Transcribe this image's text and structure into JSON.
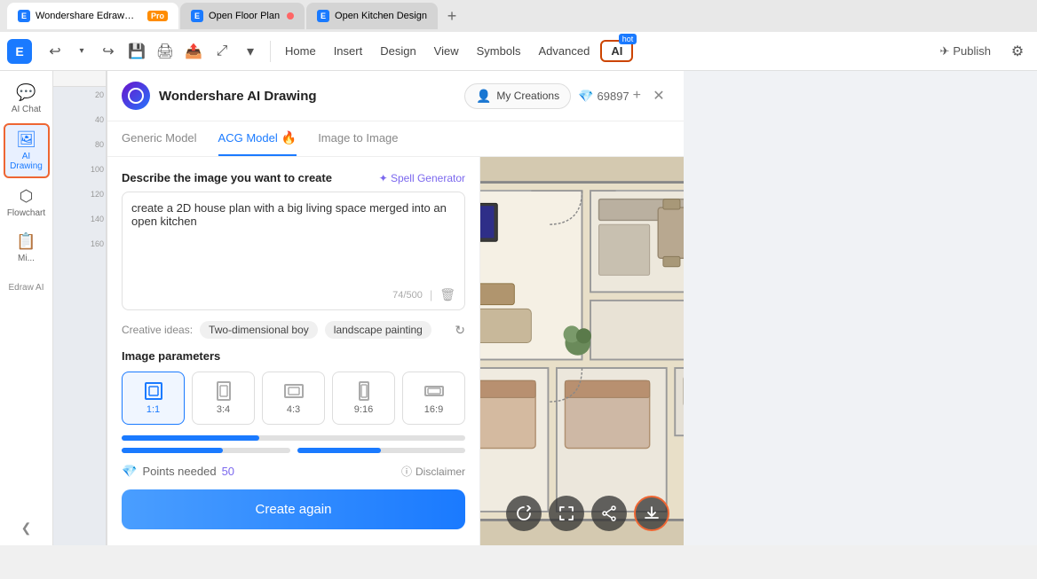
{
  "browser": {
    "tabs": [
      {
        "label": "Wondershare EdrawMax",
        "badge": "Pro",
        "active": true,
        "dot": false
      },
      {
        "label": "Open Floor Plan",
        "active": false,
        "dot": true
      },
      {
        "label": "Open Kitchen Design",
        "active": false,
        "dot": false
      }
    ],
    "add_tab_icon": "+"
  },
  "menubar": {
    "app_name": "Wondershare EdrawMax",
    "pro_badge": "Pro",
    "nav_items": [
      "Home",
      "Insert",
      "Design",
      "View",
      "Symbols",
      "Advanced"
    ],
    "ai_button_label": "AI",
    "ai_hot_badge": "hot",
    "publish_label": "Publish",
    "undo_icon": "↩",
    "redo_icon": "↪"
  },
  "sidebar": {
    "items": [
      {
        "label": "AI Chat",
        "icon": "💬",
        "active": false
      },
      {
        "label": "AI Drawing",
        "icon": "🖼",
        "active": true
      },
      {
        "label": "Flowchart",
        "icon": "⬡",
        "active": false
      },
      {
        "label": "Mi...",
        "icon": "📋",
        "active": false
      }
    ],
    "edraw_ai_label": "Edraw AI",
    "collapse_icon": "❮"
  },
  "ai_panel": {
    "title": "Wondershare AI Drawing",
    "my_creations_label": "My Creations",
    "points_count": "69897",
    "points_add_icon": "+",
    "close_icon": "✕",
    "tabs": [
      {
        "label": "Generic Model",
        "active": false,
        "fire": false
      },
      {
        "label": "ACG Model",
        "active": true,
        "fire": true
      },
      {
        "label": "Image to Image",
        "active": false,
        "fire": false
      }
    ],
    "describe_label": "Describe the image you want to create",
    "spell_generator_label": "✦ Spell Generator",
    "textarea_value": "create a 2D house plan with a big living space merged into an open kitchen",
    "char_count": "74/500",
    "delete_icon": "🗑",
    "creative_ideas_label": "Creative ideas:",
    "creative_chips": [
      "Two-dimensional boy",
      "landscape painting"
    ],
    "refresh_icon": "↻",
    "image_params_label": "Image parameters",
    "ratios": [
      {
        "label": "1:1",
        "active": true
      },
      {
        "label": "3:4",
        "active": false
      },
      {
        "label": "4:3",
        "active": false
      },
      {
        "label": "9:16",
        "active": false
      },
      {
        "label": "16:9",
        "active": false
      }
    ],
    "points_needed_label": "Points needed",
    "points_needed_value": "50",
    "disclaimer_label": "Disclaimer",
    "create_btn_label": "Create again",
    "image_actions": [
      {
        "icon": "⟳",
        "name": "regenerate",
        "highlighted": false
      },
      {
        "icon": "⤢",
        "name": "fullscreen",
        "highlighted": false
      },
      {
        "icon": "⬆",
        "name": "share",
        "highlighted": false
      },
      {
        "icon": "⬇",
        "name": "download",
        "highlighted": true
      }
    ]
  }
}
